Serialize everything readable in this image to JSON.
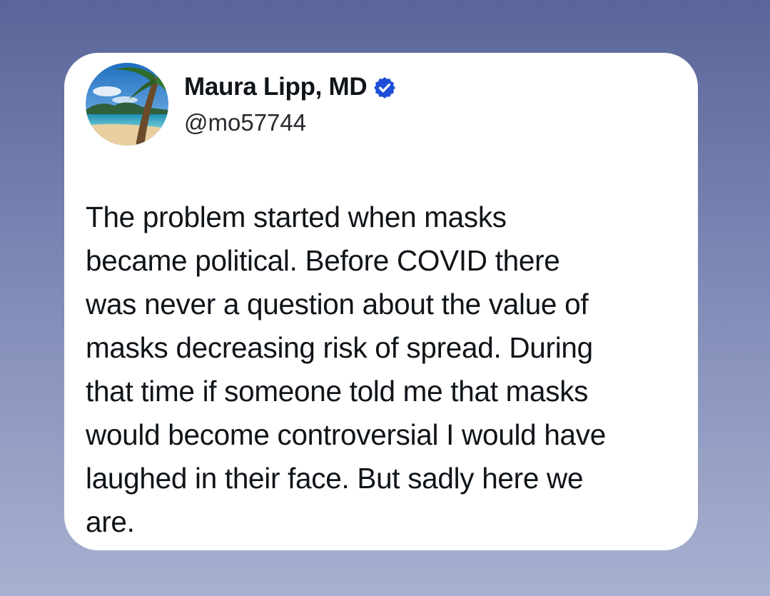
{
  "author": {
    "name": "Maura Lipp, MD",
    "handle": "@mo57744",
    "avatar_icon": "beach-palm-avatar",
    "verified_icon": "verified-badge-icon",
    "verified_color": "#1d4ed8"
  },
  "tweet": {
    "lines": [
      "The problem started when masks",
      "became political. Before COVID there",
      "was never a question about the value of",
      "masks decreasing risk of spread. During",
      "that time if someone told me that masks",
      "would become controversial I would have",
      "laughed in their face. But sadly here we",
      "are."
    ]
  },
  "colors": {
    "background_top": "#5a6699",
    "background_bottom": "#a9b1d0",
    "card": "#ffffff",
    "text": "#0f1419"
  }
}
